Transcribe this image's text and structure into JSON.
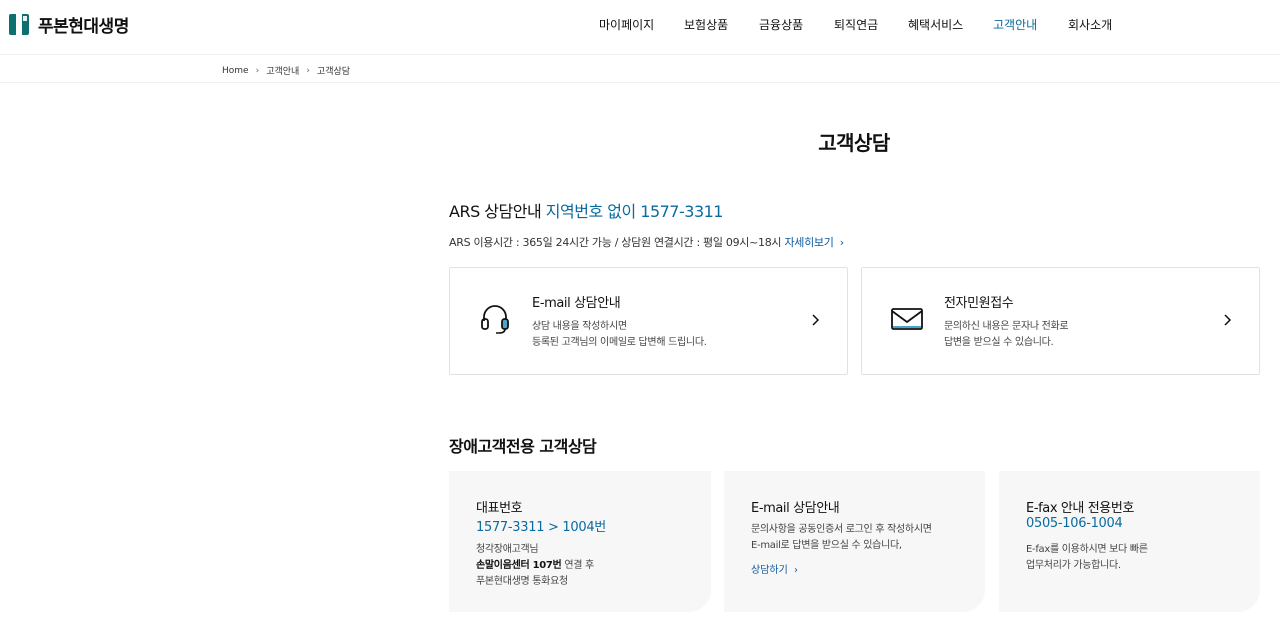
{
  "brand": {
    "name": "푸본현대생명",
    "color": "#006b6b"
  },
  "nav": {
    "items": [
      {
        "label": "마이페이지"
      },
      {
        "label": "보험상품"
      },
      {
        "label": "금융상품"
      },
      {
        "label": "퇴직연금"
      },
      {
        "label": "혜택서비스"
      },
      {
        "label": "고객안내",
        "active": true
      },
      {
        "label": "회사소개"
      }
    ]
  },
  "breadcrumb": [
    "Home",
    "고객안내",
    "고객상담"
  ],
  "page": {
    "title": "고객상담"
  },
  "ars": {
    "label": "ARS 상담안내",
    "highlight": "지역번호 없이 1577-3311",
    "hours": "ARS 이용시간 : 365일 24시간 가능 / 상담원 연결시간 : 평일 09시~18시",
    "more": "자세히보기"
  },
  "cards": [
    {
      "title": "E-mail 상담안내",
      "desc1": "상담 내용을 작성하시면",
      "desc2": "등록된 고객님의 이메일로 답변해 드립니다.",
      "icon": "headset-icon"
    },
    {
      "title": "전자민원접수",
      "desc1": "문의하신 내용은 문자나 전화로",
      "desc2": "답변을 받으실 수 있습니다.",
      "icon": "envelope-icon"
    }
  ],
  "accessibility": {
    "title": "장애고객전용 고객상담",
    "cards": [
      {
        "title": "대표번호",
        "number": "1577-3311 > 1004번",
        "desc1": "청각장애고객님",
        "desc2_bold": "손말이음센터 107번",
        "desc2_rest": " 연결 후",
        "desc3": "푸본현대생명 통화요청"
      },
      {
        "title": "E-mail 상담안내",
        "desc1": "문의사항을 공동인증서 로그인 후 작성하시면",
        "desc2": "E-mail로 답변을 받으실 수 있습니다,",
        "link": "상담하기"
      },
      {
        "title": "E-fax 안내 전용번호",
        "number": "0505-106-1004",
        "desc1": "E-fax를 이용하시면 보다 빠른",
        "desc2": "업무처리가 가능합니다."
      }
    ]
  },
  "colors": {
    "accent": "#0a6ba0",
    "card_bg": "#f7f7f7",
    "border": "#e2e2e2"
  }
}
